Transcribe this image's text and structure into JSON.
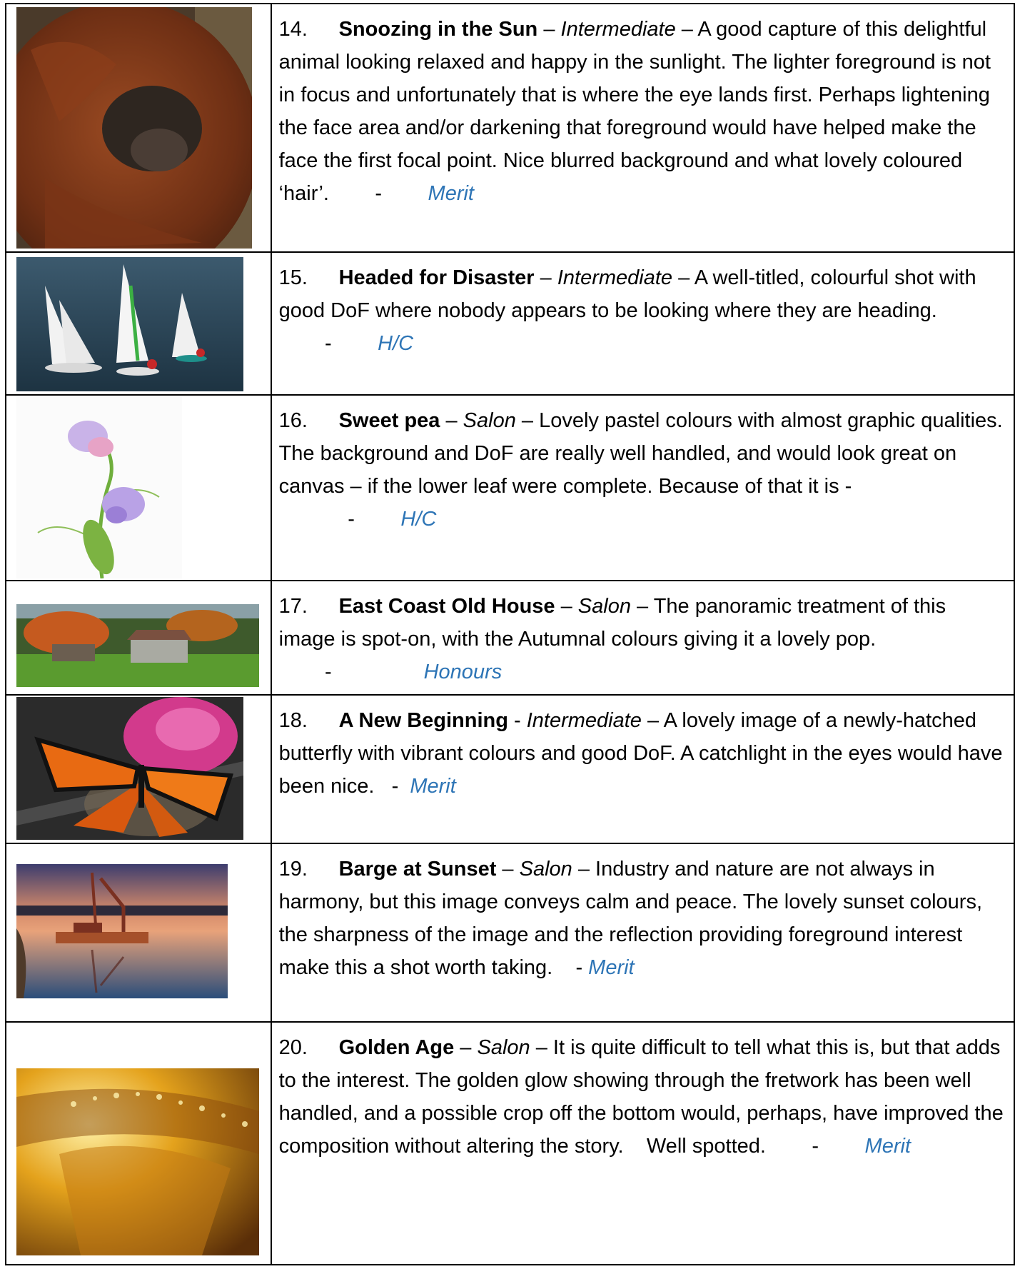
{
  "entries": [
    {
      "number": "14.",
      "title": "Snoozing in the Sun",
      "sep1": " – ",
      "category": "Intermediate",
      "sep2": " – ",
      "comment": "A good capture of this delightful animal looking relaxed and happy in the sunlight. The lighter foreground is not in focus and unfortunately that is where the eye lands first. Perhaps lightening the face area and/or darkening that foreground would have helped make the face the first focal point. Nice blurred background and what lovely coloured ‘hair’.",
      "dash": "        -        ",
      "award": "Merit",
      "image": "orangutan-photo"
    },
    {
      "number": "15.",
      "title": "Headed for Disaster",
      "sep1": " – ",
      "category": "Intermediate",
      "sep2": " – ",
      "comment": "A well-titled, colourful shot with good DoF where nobody appears to be looking where they are heading.",
      "dash": "        -        ",
      "award": "H/C",
      "image": "sailboats-photo"
    },
    {
      "number": "16.",
      "title": "Sweet pea",
      "sep1": " – ",
      "category": "Salon",
      "sep2": " – ",
      "comment": "Lovely pastel colours with almost graphic qualities. The background and DoF are really well handled, and would look great on canvas – if the lower leaf were complete. Because of that it is -",
      "dash": "            -        ",
      "award": "H/C",
      "image": "sweet-pea-photo"
    },
    {
      "number": "17.",
      "title": "East Coast Old House",
      "sep1": " – ",
      "category": "Salon",
      "sep2": " – ",
      "comment": "The panoramic treatment of this image is spot-on, with the Autumnal colours giving it a lovely pop.",
      "dash": "        -                ",
      "award": "Honours",
      "image": "old-house-photo"
    },
    {
      "number": "18.",
      "title": "A New Beginning",
      "sep1": " - ",
      "category": "Intermediate",
      "sep2": " – ",
      "comment": "A lovely image of a newly-hatched butterfly with vibrant colours and good DoF. A catchlight in the eyes would have been nice.",
      "dash": "   -  ",
      "award": "Merit",
      "image": "butterfly-photo"
    },
    {
      "number": "19.",
      "title": "Barge at Sunset",
      "sep1": " – ",
      "category": "Salon",
      "sep2": " – ",
      "comment": "Industry and nature are not always in harmony, but this image conveys calm and peace. The lovely sunset colours, the sharpness of the image and the reflection providing foreground interest make this a shot worth taking.",
      "dash": "    - ",
      "award": "Merit",
      "image": "barge-photo"
    },
    {
      "number": "20.",
      "title": "Golden Age",
      "sep1": " – ",
      "category": "Salon",
      "sep2": " – ",
      "comment": "It is quite difficult to tell what this is, but that adds to the interest. The golden glow showing through the fretwork has been well handled, and a possible crop off the bottom would, perhaps, have improved the composition without altering the story.    Well spotted.",
      "dash": "        -        ",
      "award": "Merit",
      "image": "golden-fretwork-photo"
    }
  ],
  "colors": {
    "award": "#2e75b6",
    "border": "#000000"
  }
}
